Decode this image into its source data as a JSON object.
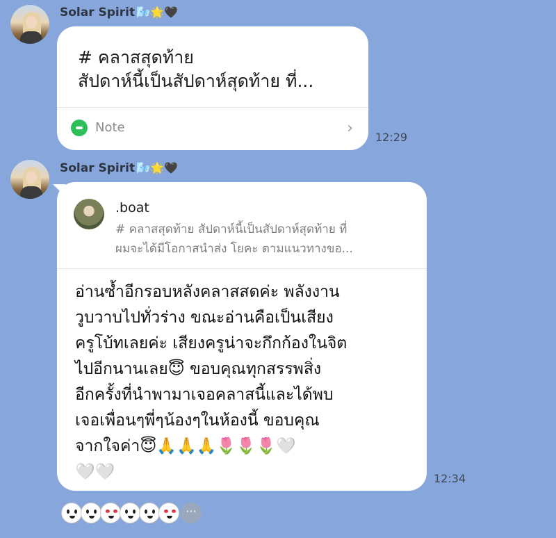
{
  "messages": [
    {
      "sender": "Solar Spirit",
      "sender_deco": "🌬️🌟🖤",
      "type": "note",
      "note": {
        "title_line1": "# คลาสสุดท้าย",
        "title_line2": "สัปดาห์นี้เป็นสัปดาห์สุดท้าย ที่...",
        "label": "Note",
        "chevron": "›"
      },
      "time": "12:29"
    },
    {
      "sender": "Solar Spirit",
      "sender_deco": "🌬️🌟🖤",
      "type": "reply",
      "quote": {
        "name": ".boat",
        "line1": "# คลาสสุดท้าย สัปดาห์นี้เป็นสัปดาห์สุดท้าย ที่",
        "line2": "ผมจะได้มีโอกาสนำส่ง โยคะ ตามแนวทางขอ..."
      },
      "lines": [
        "อ่านซ้ำอีกรอบหลังคลาสสดค่ะ พลังงาน",
        "วูบวาบไปทั่วร่าง ขณะอ่านคือเป็นเสียง",
        "ครูโบ้ทเลยค่ะ เสียงครูน่าจะกึกก้องในจิต",
        "ไปอีกนานเลย😇 ขอบคุณทุกสรรพสิ่ง",
        "อีกครั้งที่นำพามาเจอคลาสนี้และได้พบ",
        "เจอเพื่อนๆพี่ๆน้องๆในห้องนี้ ขอบคุณ",
        "จากใจค่า😇🙏🙏🙏🌷🌷🌷🤍",
        "🤍🤍"
      ],
      "time": "12:34"
    }
  ],
  "reactions": {
    "stickers": [
      "sticker-face",
      "sticker-face",
      "sticker-heart-eyes",
      "sticker-face",
      "sticker-face",
      "sticker-heart-eyes"
    ],
    "more_label": "···"
  },
  "colors": {
    "background": "#87a7dc",
    "bubble": "#ffffff",
    "note_icon": "#2dbf5a"
  }
}
